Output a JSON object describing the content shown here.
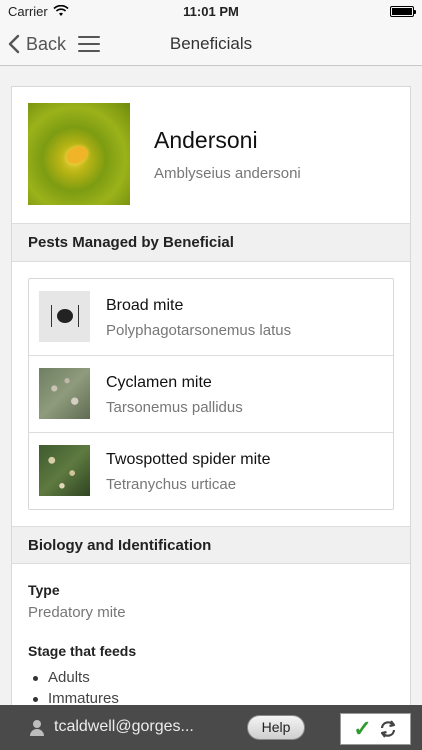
{
  "status_bar": {
    "carrier": "Carrier",
    "time": "11:01 PM"
  },
  "nav": {
    "back_label": "Back",
    "title": "Beneficials"
  },
  "beneficial": {
    "name": "Andersoni",
    "scientific_name": "Amblyseius andersoni"
  },
  "pests_section": {
    "title": "Pests Managed by Beneficial",
    "items": [
      {
        "name": "Broad mite",
        "scientific_name": "Polyphagotarsonemus latus"
      },
      {
        "name": "Cyclamen mite",
        "scientific_name": "Tarsonemus pallidus"
      },
      {
        "name": "Twospotted spider mite",
        "scientific_name": "Tetranychus urticae"
      }
    ]
  },
  "biology_section": {
    "title": "Biology and Identification",
    "type_label": "Type",
    "type_value": "Predatory mite",
    "stage_label": "Stage that feeds",
    "stages": [
      "Adults",
      "Immatures"
    ]
  },
  "bottom_bar": {
    "user": "tcaldwell@gorges...",
    "help_label": "Help"
  },
  "icons": [
    "wifi-icon",
    "battery-icon",
    "chevron-left-icon",
    "hamburger-menu-icon",
    "user-icon",
    "checkmark-icon",
    "sync-icon"
  ],
  "colors": {
    "sync_check": "#2e9b2e",
    "bottom_bar": "#4a4a4a"
  }
}
